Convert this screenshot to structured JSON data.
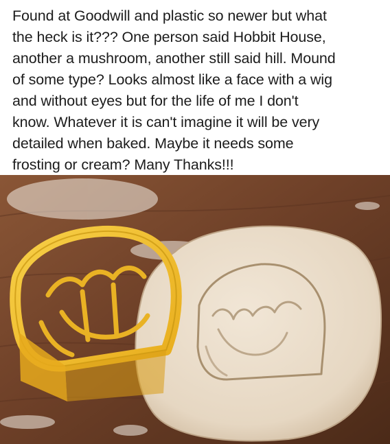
{
  "post": {
    "text": "Found at Goodwill and plastic so newer but what\nthe heck is it??? One person said Hobbit House,\nanother a mushroom, another still said hill. Mound\nof some type? Looks almost like a face with a wig\nand without eyes but for the life of me I don't\nknow. Whatever it is can't imagine it will be very\ndetailed when baked. Maybe it needs some\nfrosting or cream? Many Thanks!!!"
  },
  "photo": {
    "subject": "yellow-cookie-cutter-and-rolled-dough",
    "colors": {
      "table": "#7a4a2e",
      "table_dark": "#4e2c1a",
      "dough": "#e9dccb",
      "dough_shadow": "#c9b59c",
      "cutter": "#f2c12e",
      "cutter_dark": "#c8950f",
      "flour": "#f4efe6"
    }
  }
}
